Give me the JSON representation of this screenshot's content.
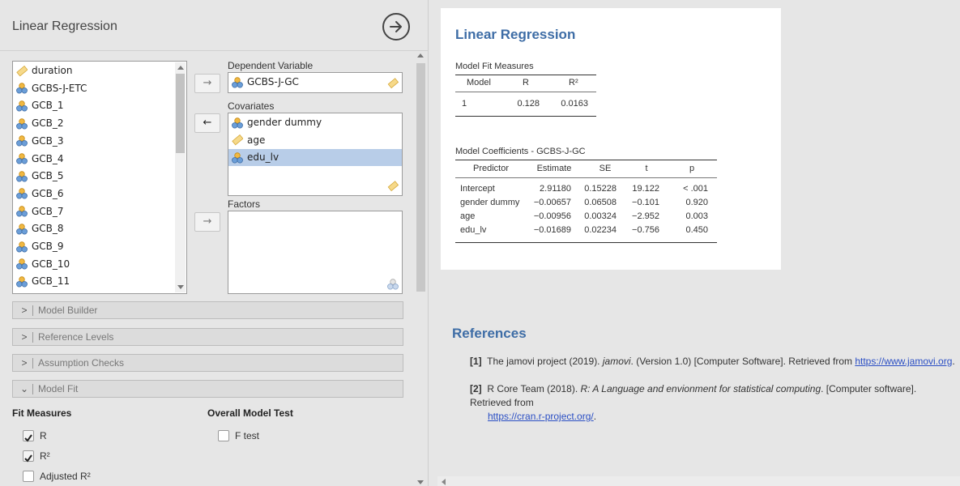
{
  "options": {
    "title": "Linear Regression",
    "variables": [
      "duration",
      "GCBS-J-ETC",
      "GCB_1",
      "GCB_2",
      "GCB_3",
      "GCB_4",
      "GCB_5",
      "GCB_6",
      "GCB_7",
      "GCB_8",
      "GCB_9",
      "GCB_10",
      "GCB_11"
    ],
    "variable_types": [
      "continuous",
      "nominal",
      "nominal",
      "nominal",
      "nominal",
      "nominal",
      "nominal",
      "nominal",
      "nominal",
      "nominal",
      "nominal",
      "nominal",
      "nominal"
    ],
    "move_right": "→",
    "move_left": "←",
    "dependent_label": "Dependent Variable",
    "dependent_value": "GCBS-J-GC",
    "covariates_label": "Covariates",
    "covariates": [
      {
        "name": "gender dummy",
        "type": "nominal"
      },
      {
        "name": "age",
        "type": "continuous"
      },
      {
        "name": "edu_lv",
        "type": "nominal",
        "selected": true
      }
    ],
    "factors_label": "Factors",
    "sections": [
      {
        "label": "Model Builder",
        "expanded": false
      },
      {
        "label": "Reference Levels",
        "expanded": false
      },
      {
        "label": "Assumption Checks",
        "expanded": false
      },
      {
        "label": "Model Fit",
        "expanded": true
      }
    ],
    "fit_measures_title": "Fit Measures",
    "fit_measures": [
      {
        "label": "R",
        "checked": true
      },
      {
        "label": "R²",
        "checked": true
      },
      {
        "label": "Adjusted R²",
        "checked": false
      }
    ],
    "overall_test_title": "Overall Model Test",
    "overall_tests": [
      {
        "label": "F test",
        "checked": false
      }
    ]
  },
  "results": {
    "title": "Linear Regression",
    "fit_table": {
      "title": "Model Fit Measures",
      "headers": [
        "Model",
        "R",
        "R²"
      ],
      "rows": [
        [
          "1",
          "0.128",
          "0.0163"
        ]
      ]
    },
    "coef_table": {
      "title": "Model Coefficients - GCBS-J-GC",
      "headers": [
        "Predictor",
        "Estimate",
        "SE",
        "t",
        "p"
      ],
      "rows": [
        [
          "Intercept",
          "2.91180",
          "0.15228",
          "19.122",
          "< .001"
        ],
        [
          "gender dummy",
          "−0.00657",
          "0.06508",
          "−0.101",
          "0.920"
        ],
        [
          "age",
          "−0.00956",
          "0.00324",
          "−2.952",
          "0.003"
        ],
        [
          "edu_lv",
          "−0.01689",
          "0.02234",
          "−0.756",
          "0.450"
        ]
      ]
    }
  },
  "references": {
    "title": "References",
    "items": [
      {
        "num": "[1]",
        "pre": "The jamovi project (2019). ",
        "ital": "jamovi",
        "post": ". (Version 1.0) [Computer Software]. Retrieved from ",
        "link": "https://www.jamovi.org",
        "end": "."
      },
      {
        "num": "[2]",
        "pre": "R Core Team (2018). ",
        "ital": "R: A Language and envionment for statistical computing",
        "post": ". [Computer software]. Retrieved from ",
        "link": "https://cran.r-project.org/",
        "end": "."
      }
    ]
  },
  "colors": {
    "accent": "#3e6da6",
    "selection": "#b8cde8",
    "link": "#2b4fc4"
  }
}
